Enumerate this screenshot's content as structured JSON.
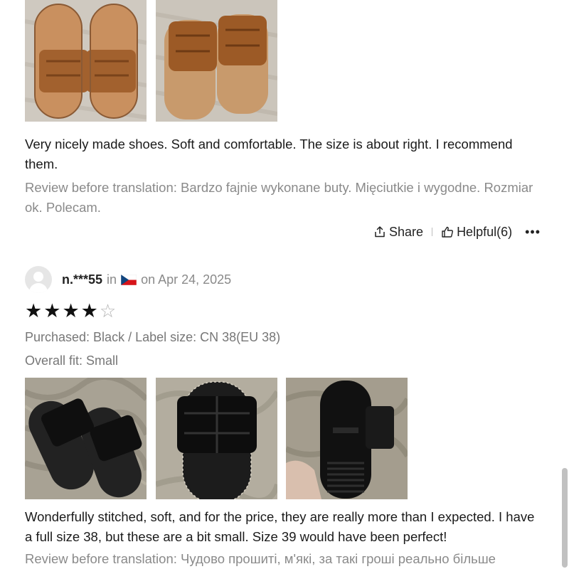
{
  "review1": {
    "text": "Very nicely made shoes. Soft and comfortable. The size is about right. I recommend them.",
    "original": "Review before translation: Bardzo fajnie wykonane buty. Mięciutkie i wygodne. Rozmiar ok. Polecam.",
    "share_label": "Share",
    "helpful_label": "Helpful(6)",
    "more_label": "•••"
  },
  "review2": {
    "username": "n.***55",
    "in_label": "in",
    "country_flag": "czech-flag",
    "date": "on Apr 24, 2025",
    "rating": 4,
    "rating_max": 5,
    "purchased": "Purchased: Black / Label size: CN 38(EU 38)",
    "fit": "Overall fit: Small",
    "text": "Wonderfully stitched, soft, and for the price, they are really more than I expected. I have a full size 38, but these are a bit small. Size 39 would have been perfect!",
    "original": "Review before translation: Чудово прошиті, м'які, за такі гроші реально більше"
  },
  "colors": {
    "text": "#1a1a1a",
    "muted": "#8a8a8a",
    "tan_sandal": "#a86a3a",
    "black_sandal": "#1a1a1a"
  }
}
